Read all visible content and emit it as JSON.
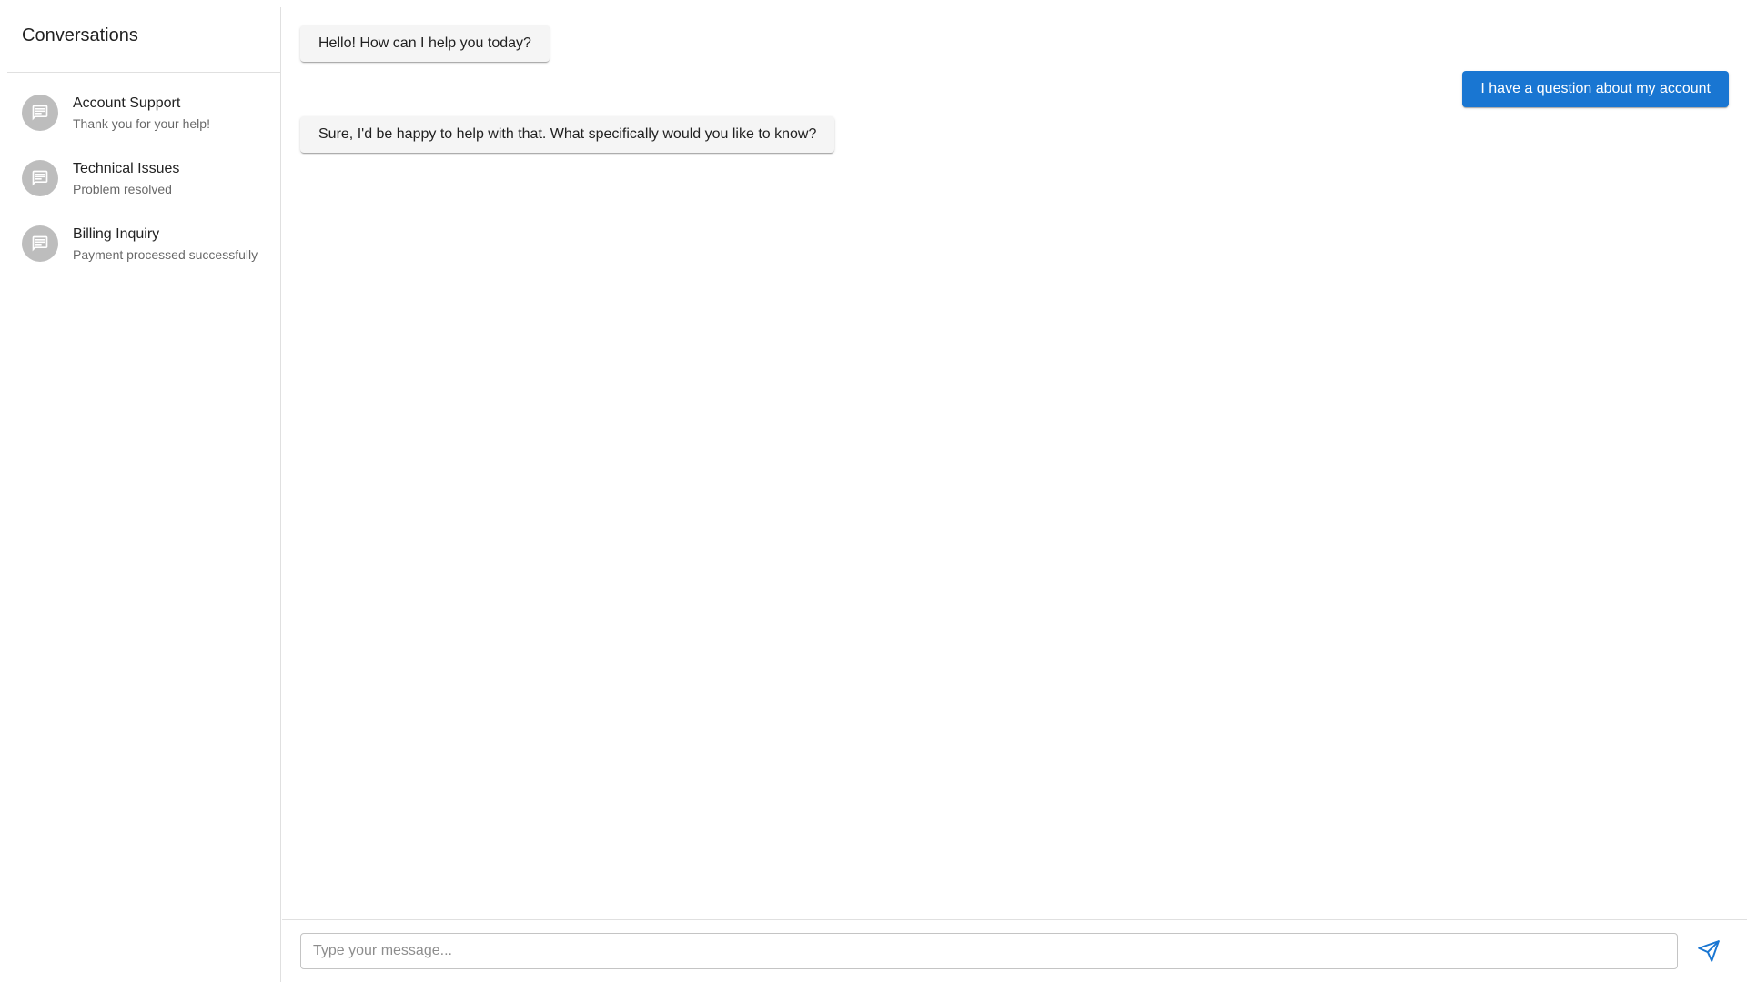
{
  "sidebar": {
    "title": "Conversations",
    "items": [
      {
        "title": "Account Support",
        "subtitle": "Thank you for your help!",
        "icon": "chat-icon"
      },
      {
        "title": "Technical Issues",
        "subtitle": "Problem resolved",
        "icon": "chat-icon"
      },
      {
        "title": "Billing Inquiry",
        "subtitle": "Payment processed successfully",
        "icon": "chat-icon"
      }
    ]
  },
  "messages": [
    {
      "sender": "agent",
      "text": "Hello! How can I help you today?"
    },
    {
      "sender": "user",
      "text": "I have a question about my account"
    },
    {
      "sender": "agent",
      "text": "Sure, I'd be happy to help with that. What specifically would you like to know?"
    }
  ],
  "composer": {
    "placeholder": "Type your message...",
    "value": "",
    "send_icon": "send-icon"
  },
  "colors": {
    "accent": "#1976d2",
    "agent_bubble": "#f5f5f5",
    "avatar_bg": "#bdbdbd",
    "divider": "#e0e0e0"
  }
}
